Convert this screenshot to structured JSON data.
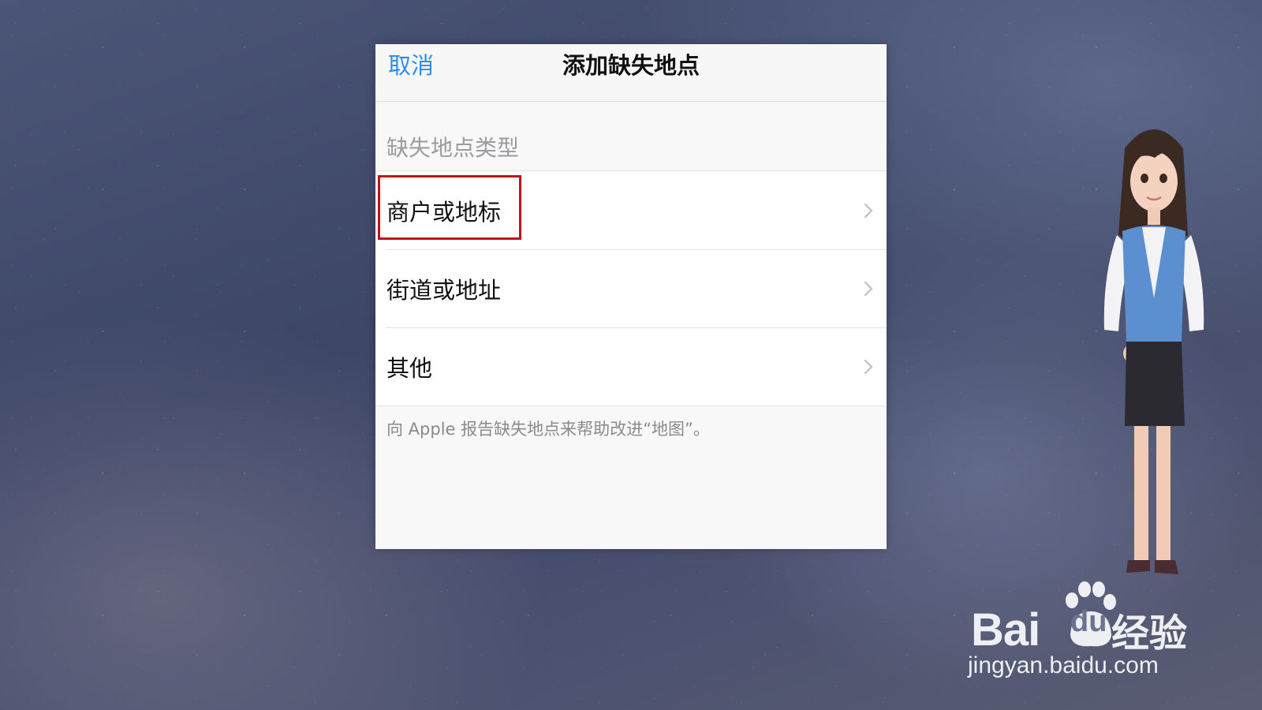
{
  "navbar": {
    "cancel_label": "取消",
    "title": "添加缺失地点"
  },
  "section": {
    "header": "缺失地点类型",
    "items": [
      {
        "label": "商户或地标",
        "icon": "chevron-right-icon",
        "highlighted": true
      },
      {
        "label": "街道或地址",
        "icon": "chevron-right-icon",
        "highlighted": false
      },
      {
        "label": "其他",
        "icon": "chevron-right-icon",
        "highlighted": false
      }
    ],
    "footer": "向 Apple 报告缺失地点来帮助改进“地图”。"
  },
  "watermark": {
    "brand_bai": "Bai",
    "brand_du": "du",
    "brand_suffix": "经验",
    "url": "jingyan.baidu.com"
  },
  "colors": {
    "accent": "#2f8ce9",
    "highlight": "#c0141a"
  }
}
